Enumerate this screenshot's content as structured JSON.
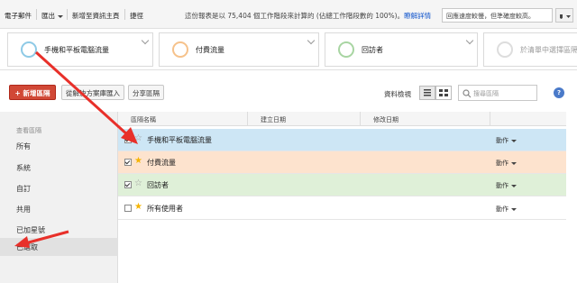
{
  "topbar": {
    "email": "電子郵件",
    "export": "匯出",
    "add_dashboard": "新增至資訊主頁",
    "shortcut": "捷徑",
    "sample_text": "這份報表是以 75,404 個工作階段來計算的 (佔總工作階段數的 100%)。",
    "sample_link": "瞭解詳情",
    "speed_select": "回應速度較慢，但準確度較高。"
  },
  "segments": [
    {
      "label": "手機和平板電腦流量",
      "ring_color": "#8ecae6"
    },
    {
      "label": "付費流量",
      "ring_color": "#f6c28b"
    },
    {
      "label": "回訪者",
      "ring_color": "#a8d5a2"
    },
    {
      "label": "於清單中選擇區隔",
      "ring_color": "#dddddd"
    }
  ],
  "actions": {
    "new_segment": "+ 新增區隔",
    "import_gallery": "從解決方案庫匯入",
    "share_segments": "分享區隔",
    "view_label": "資料檢視",
    "search_placeholder": "搜尋區隔",
    "help": "?"
  },
  "left_panel": {
    "heading": "查看區隔",
    "items": [
      "所有",
      "系統",
      "自訂",
      "共用",
      "已加星號",
      "已選取"
    ]
  },
  "table": {
    "headers": [
      "區隔名稱",
      "建立日期",
      "修改日期"
    ],
    "rows": [
      {
        "name": "手機和平板電腦流量",
        "checked": true,
        "starred": false,
        "action": "動作",
        "bg": "#cde6f5"
      },
      {
        "name": "付費流量",
        "checked": true,
        "starred": true,
        "action": "動作",
        "bg": "#fde3ce"
      },
      {
        "name": "回訪者",
        "checked": true,
        "starred": false,
        "action": "動作",
        "bg": "#dff0d8"
      },
      {
        "name": "所有使用者",
        "checked": false,
        "starred": true,
        "action": "動作",
        "bg": "#ffffff"
      }
    ]
  },
  "colors": {
    "arrow": "#e8302a",
    "star_on": "#f5b400",
    "star_off": "#9a9a9a"
  }
}
